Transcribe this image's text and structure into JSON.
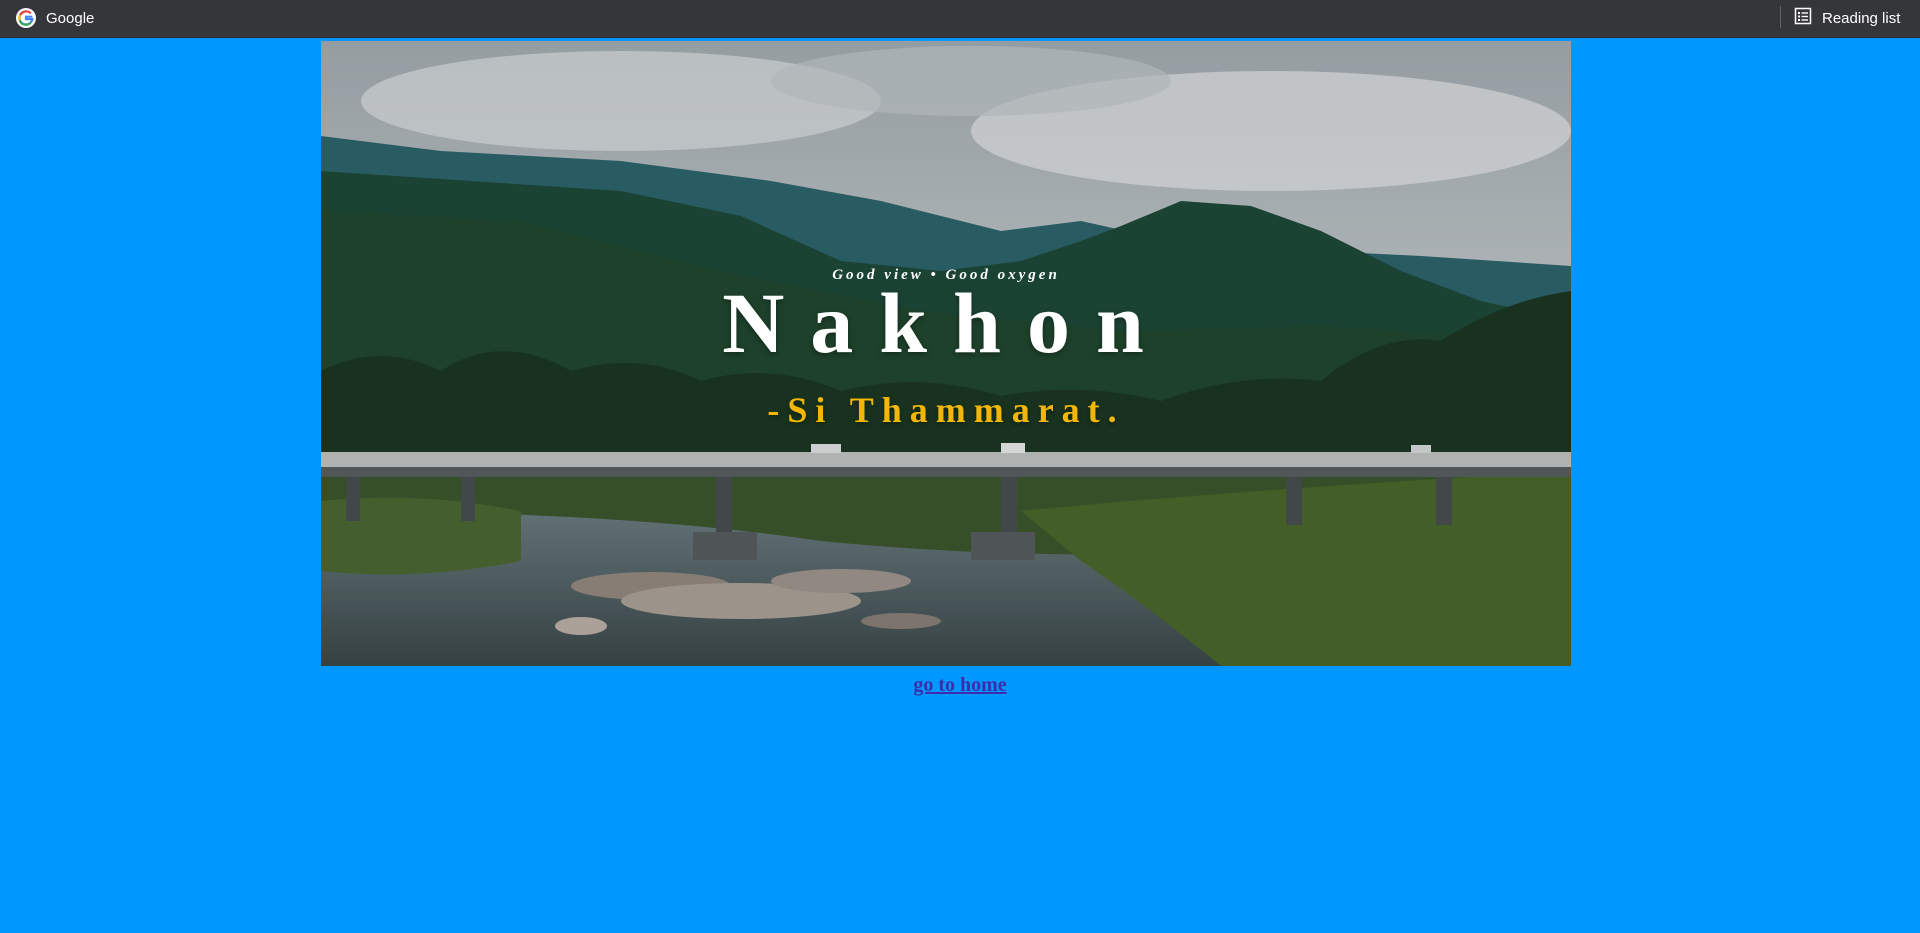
{
  "bookmarks": {
    "google_label": "Google",
    "reading_list_label": "Reading list"
  },
  "banner": {
    "tagline": "Good view • Good oxygen",
    "title": "Nakhon",
    "subtitle": "-Si Thammarat."
  },
  "link": {
    "text": "go to home"
  },
  "colors": {
    "page_background": "#0098fe",
    "bookmarks_bar": "#35363a",
    "subtitle": "#f2b705",
    "link": "#3b2dab"
  },
  "icons": {
    "google": "google-icon",
    "reading_list": "reading-list-icon"
  }
}
